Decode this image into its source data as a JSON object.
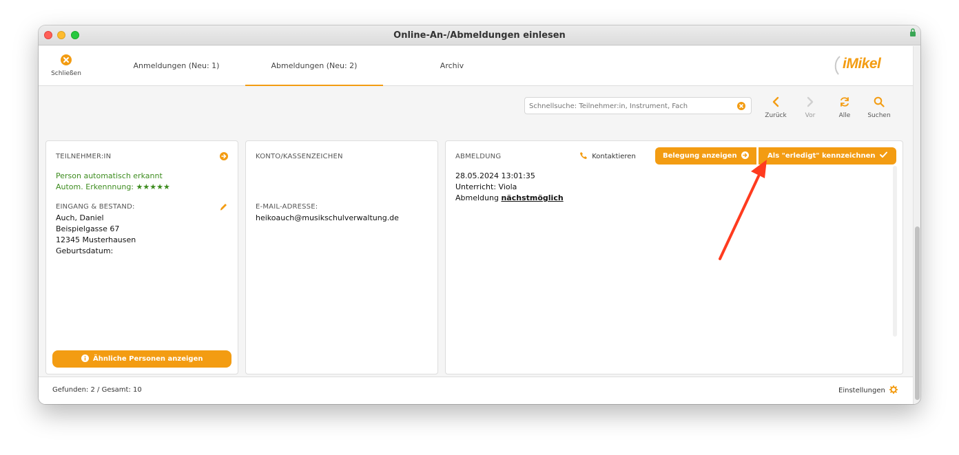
{
  "window": {
    "title": "Online-An-/Abmeldungen einlesen"
  },
  "tabs": {
    "close_label": "Schließen",
    "items": [
      {
        "label": "Anmeldungen (Neu: 1)"
      },
      {
        "label": "Abmeldungen (Neu: 2)"
      },
      {
        "label": "Archiv"
      }
    ]
  },
  "logo": {
    "text": "iMikel"
  },
  "toolbar": {
    "search_placeholder": "Schnellsuche: Teilnehmer:in, Instrument, Fach",
    "back_label": "Zurück",
    "forward_label": "Vor",
    "all_label": "Alle",
    "search_label": "Suchen"
  },
  "participant": {
    "heading": "TEILNEHMER:IN",
    "auto_detected": "Person automatisch erkannt",
    "recognition_label": "Autom. Erkennnung:",
    "recognition_stars": "★★★★★",
    "entry_heading": "EINGANG & BESTAND:",
    "name": "Auch, Daniel",
    "street": "Beispielgasse 67",
    "city": "12345 Musterhausen",
    "birthdate_label": "Geburtsdatum:",
    "similar_button": "Ähnliche Personen anzeigen"
  },
  "account": {
    "heading": "KONTO/KASSENZEICHEN",
    "email_heading": "E-MAIL-ADRESSE:",
    "email": "heikoauch@musikschulverwaltung.de"
  },
  "deregistration": {
    "heading": "ABMELDUNG",
    "contact_label": "Kontaktieren",
    "show_booking_button": "Belegung anzeigen",
    "mark_done_button": "Als \"erledigt\" kennzeichnen",
    "datetime": "28.05.2024 13:01:35",
    "lesson_text": "Unterricht: Viola",
    "deregistration_prefix": "Abmeldung",
    "deregistration_link": "nächstmöglich"
  },
  "footer": {
    "found_text": "Gefunden: 2 / Gesamt: 10",
    "settings_label": "Einstellungen"
  },
  "colors": {
    "accent": "#f39c12",
    "success": "#3d8c1f",
    "annotation_arrow": "#ff3b1f"
  }
}
